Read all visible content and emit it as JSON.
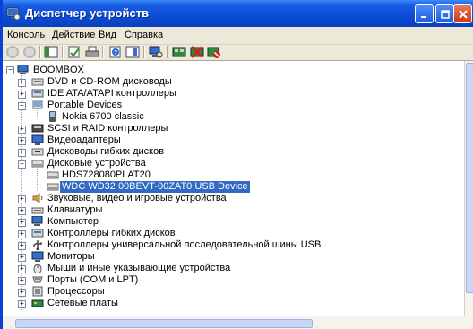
{
  "window": {
    "title": "Диспетчер устройств",
    "buttons": [
      "minimize",
      "maximize",
      "close"
    ]
  },
  "menu": [
    "Консоль",
    "Действие",
    "Вид",
    "Справка"
  ],
  "toolbar": {
    "buttons": [
      {
        "name": "back-icon"
      },
      {
        "name": "forward-icon"
      },
      {
        "name": "console-tree-icon"
      },
      {
        "name": "properties-icon"
      },
      {
        "name": "print-icon"
      },
      {
        "name": "help-icon"
      },
      {
        "name": "view-icon"
      },
      {
        "name": "scan-hardware-icon"
      },
      {
        "name": "update-driver-icon"
      },
      {
        "name": "disable-icon"
      },
      {
        "name": "uninstall-icon"
      }
    ]
  },
  "tree": {
    "root": "BOOMBOX",
    "items": [
      {
        "label": "DVD и CD-ROM дисководы",
        "level": 1,
        "expander": "+",
        "icon": "dvd-drive-icon"
      },
      {
        "label": "IDE ATA/ATAPI контроллеры",
        "level": 1,
        "expander": "+",
        "icon": "ide-controller-icon"
      },
      {
        "label": "Portable Devices",
        "level": 1,
        "expander": "-",
        "icon": "portable-devices-icon"
      },
      {
        "label": "Nokia 6700 classic",
        "level": 2,
        "expander": "",
        "icon": "phone-icon"
      },
      {
        "label": "SCSI и RAID контроллеры",
        "level": 1,
        "expander": "+",
        "icon": "scsi-controller-icon"
      },
      {
        "label": "Видеоадаптеры",
        "level": 1,
        "expander": "+",
        "icon": "display-adapter-icon"
      },
      {
        "label": "Дисководы гибких дисков",
        "level": 1,
        "expander": "+",
        "icon": "floppy-drive-icon"
      },
      {
        "label": "Дисковые устройства",
        "level": 1,
        "expander": "-",
        "icon": "disk-drive-icon"
      },
      {
        "label": "HDS728080PLAT20",
        "level": 2,
        "expander": "",
        "icon": "hard-disk-icon"
      },
      {
        "label": "WDC WD32 00BEVT-00ZAT0 USB Device",
        "level": 2,
        "expander": "",
        "icon": "hard-disk-icon",
        "selected": true
      },
      {
        "label": "Звуковые, видео и игровые устройства",
        "level": 1,
        "expander": "+",
        "icon": "sound-icon"
      },
      {
        "label": "Клавиатуры",
        "level": 1,
        "expander": "+",
        "icon": "keyboard-icon"
      },
      {
        "label": "Компьютер",
        "level": 1,
        "expander": "+",
        "icon": "computer-icon"
      },
      {
        "label": "Контроллеры гибких дисков",
        "level": 1,
        "expander": "+",
        "icon": "floppy-controller-icon"
      },
      {
        "label": "Контроллеры универсальной последовательной шины USB",
        "level": 1,
        "expander": "+",
        "icon": "usb-icon"
      },
      {
        "label": "Мониторы",
        "level": 1,
        "expander": "+",
        "icon": "monitor-icon"
      },
      {
        "label": "Мыши и иные указывающие устройства",
        "level": 1,
        "expander": "+",
        "icon": "mouse-icon"
      },
      {
        "label": "Порты (COM и LPT)",
        "level": 1,
        "expander": "+",
        "icon": "port-icon"
      },
      {
        "label": "Процессоры",
        "level": 1,
        "expander": "+",
        "icon": "processor-icon"
      },
      {
        "label": "Сетевые платы",
        "level": 1,
        "expander": "+",
        "icon": "network-adapter-icon"
      }
    ]
  },
  "colors": {
    "titlebar": "#0c4fd9",
    "selection": "#316ac5",
    "chrome": "#ece9d8"
  }
}
